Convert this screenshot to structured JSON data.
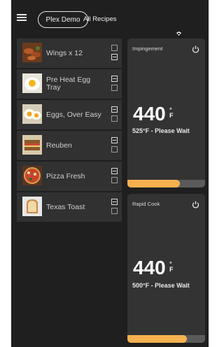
{
  "header": {
    "menu_icon": "hamburger-icon",
    "device_label": "Plex Demo",
    "all_recipes_label": "All Recipes",
    "status_icon": "wifi-status-icon"
  },
  "recipes": [
    {
      "name": "Wings x 12",
      "thumb": "wings-thumb",
      "checkboxes": [
        false,
        true
      ]
    },
    {
      "name": "Pre Heat Egg Tray",
      "thumb": "egg-thumb",
      "checkboxes": [
        true,
        false
      ]
    },
    {
      "name": "Eggs, Over Easy",
      "thumb": "eggs-thumb",
      "checkboxes": [
        true,
        false
      ]
    },
    {
      "name": "Reuben",
      "thumb": "reuben-thumb",
      "checkboxes": [
        true,
        false
      ]
    },
    {
      "name": "Pizza  Fresh",
      "thumb": "pizza-thumb",
      "checkboxes": [
        true,
        false
      ]
    },
    {
      "name": "Texas Toast",
      "thumb": "toast-thumb",
      "checkboxes": [
        true,
        false
      ]
    }
  ],
  "cavities": [
    {
      "title": "Impingement",
      "temp": "440",
      "unit_top": "°",
      "unit_bottom": "F",
      "status": "525°F - Please Wait",
      "progress": 0.68
    },
    {
      "title": "Rapid Cook",
      "temp": "440",
      "unit_top": "°",
      "unit_bottom": "F",
      "status": "500°F - Please Wait",
      "progress": 0.77
    }
  ],
  "colors": {
    "accent": "#f5b14f",
    "panel": "#333333",
    "background": "#1f1f1f"
  }
}
